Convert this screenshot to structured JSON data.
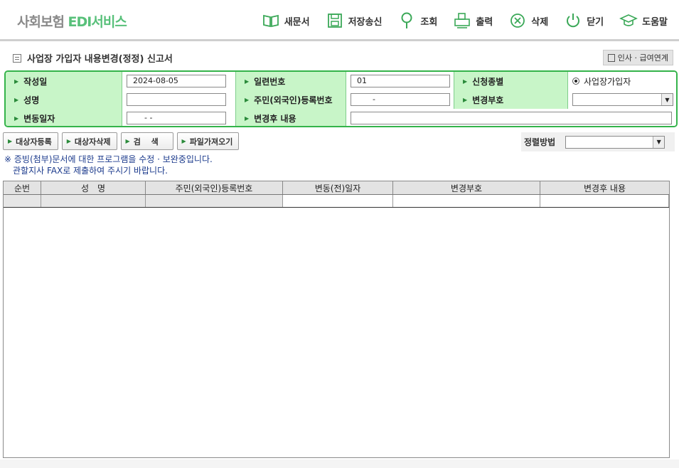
{
  "app": {
    "brand_part1": "사회보험",
    "brand_part2": "EDI서비스"
  },
  "toolbar": [
    {
      "label": "새문서",
      "icon": "open-book-icon"
    },
    {
      "label": "저장송신",
      "icon": "floppy-disk-icon"
    },
    {
      "label": "조회",
      "icon": "magnifier-icon"
    },
    {
      "label": "출력",
      "icon": "printer-icon"
    },
    {
      "label": "삭제",
      "icon": "delete-circle-icon"
    },
    {
      "label": "닫기",
      "icon": "power-icon"
    },
    {
      "label": "도움말",
      "icon": "graduation-cap-icon"
    }
  ],
  "page": {
    "title": "사업장 가입자 내용변경(정정) 신고서",
    "link_button": "인사 · 급여연계"
  },
  "form": {
    "written_date_label": "작성일",
    "written_date_value": "2024-08-05",
    "serial_no_label": "일련번호",
    "serial_no_value": "01",
    "apply_type_label": "신청종별",
    "apply_type_value": "사업장가입자",
    "name_label": "성명",
    "name_value": "",
    "rrn_label": "주민(외국인)등록번호",
    "rrn_value": "-",
    "change_code_label": "변경부호",
    "change_code_value": "",
    "change_date_label": "변동일자",
    "change_date_value": "- -",
    "after_change_label": "변경후 내용",
    "after_change_value": ""
  },
  "actions": {
    "register_target": "대상자등록",
    "delete_target": "대상자삭제",
    "search": "검　 색",
    "import_file": "파일가져오기",
    "sort_label": "정렬방법",
    "sort_value": ""
  },
  "notice": {
    "line1": "※ 증빙(첨부)문서에 대한 프로그램을 수정 · 보완중입니다.",
    "line2": "관할지사 FAX로 제출하여 주시기 바랍니다."
  },
  "table": {
    "headers": [
      "순번",
      "성　명",
      "주민(외국인)등록번호",
      "변동(전)일자",
      "변경부호",
      "변경후 내용"
    ]
  },
  "colors": {
    "accent_green": "#34b34a",
    "label_bg": "#c8f5c8",
    "notice_text": "#1b3a8c"
  }
}
